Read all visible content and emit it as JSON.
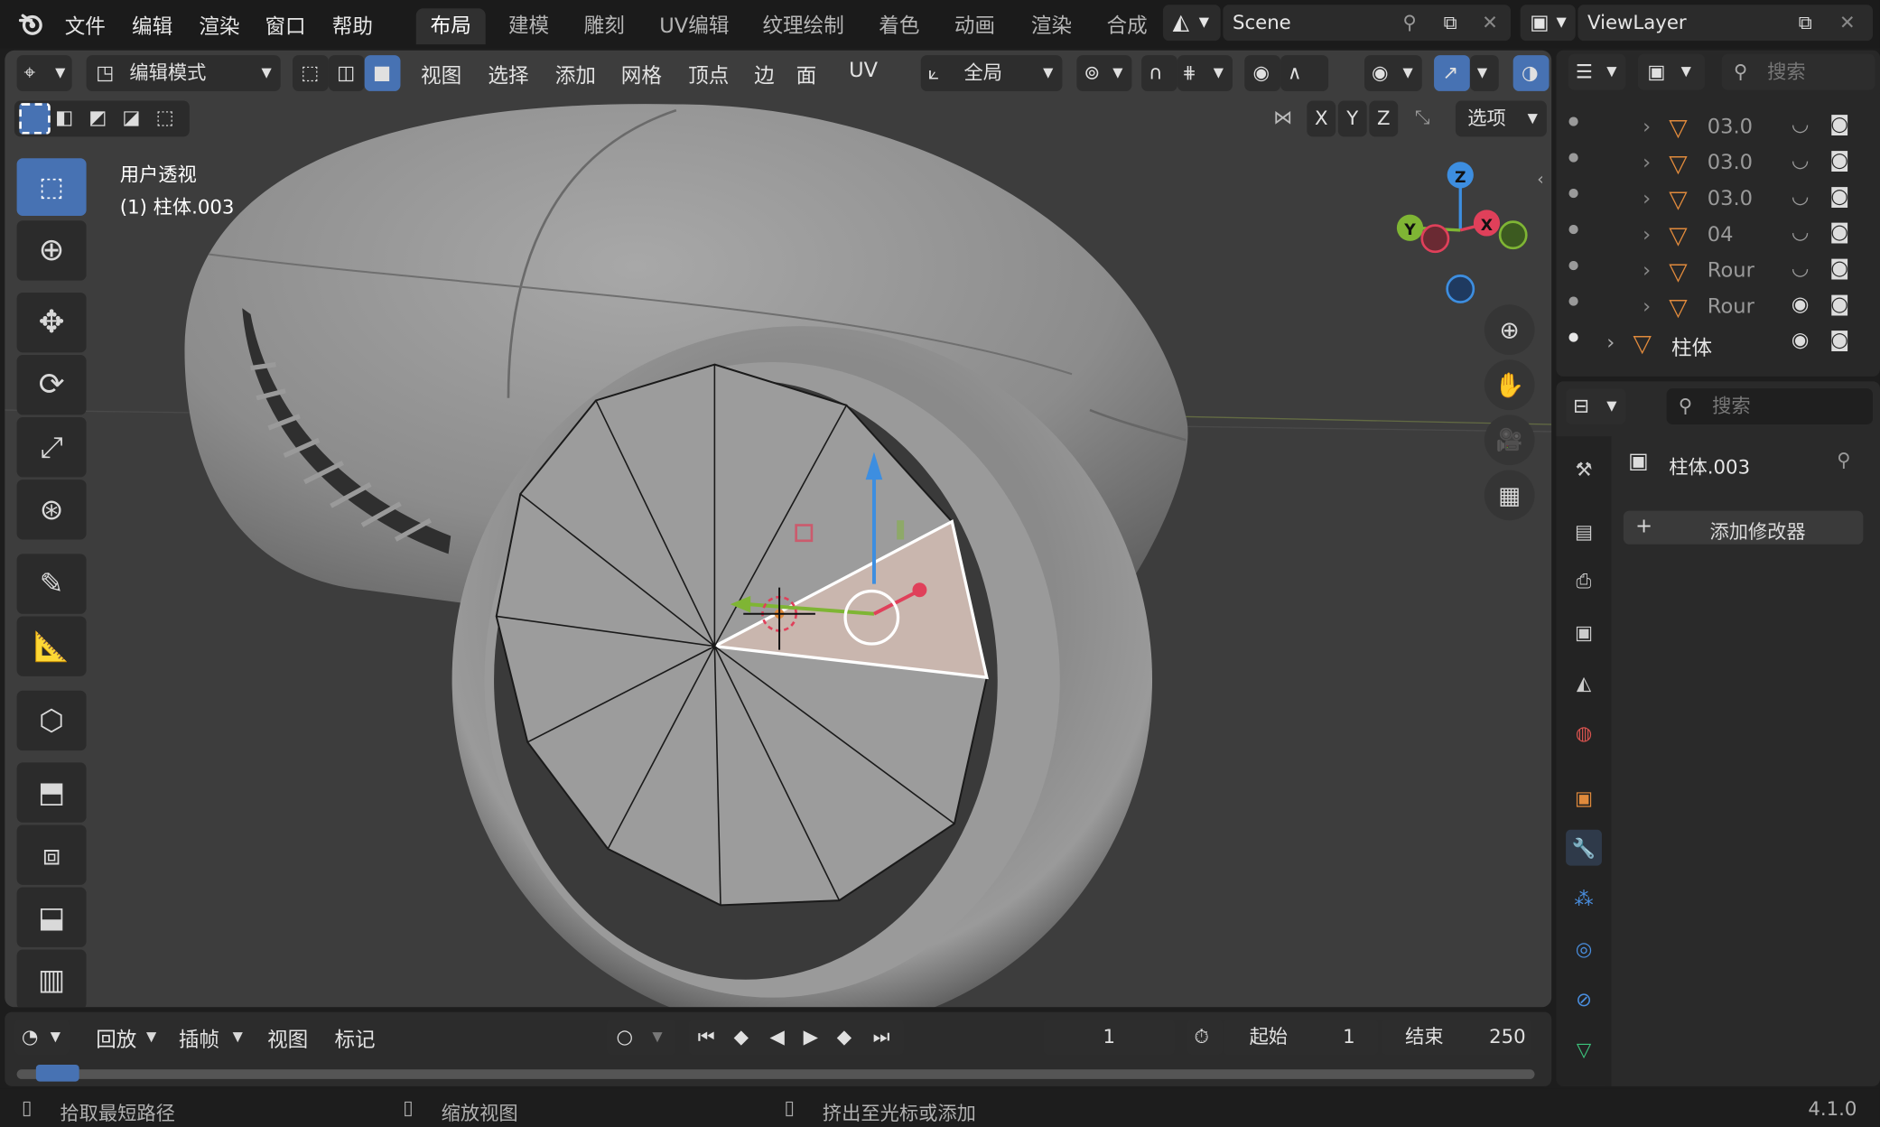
{
  "menubar": {
    "menus": [
      "文件",
      "编辑",
      "渲染",
      "窗口",
      "帮助"
    ],
    "workspaces": [
      "布局",
      "建模",
      "雕刻",
      "UV编辑",
      "纹理绘制",
      "着色",
      "动画",
      "渲染",
      "合成"
    ],
    "active_workspace": "布局",
    "scene": "Scene",
    "view_layer": "ViewLayer"
  },
  "viewport_header": {
    "mode": "编辑模式",
    "menus": [
      "视图",
      "选择",
      "添加",
      "网格",
      "顶点",
      "边",
      "面",
      "UV"
    ],
    "orientation": "全局",
    "axes": [
      "X",
      "Y",
      "Z"
    ],
    "options": "选项"
  },
  "viewport": {
    "view_name": "用户透视",
    "object_name": "(1) 柱体.003",
    "gizmo_axes": [
      "Z",
      "Y",
      "X"
    ]
  },
  "outliner": {
    "search_placeholder": "搜索",
    "rows": [
      {
        "name": "03.0"
      },
      {
        "name": "03.0"
      },
      {
        "name": "03.0"
      },
      {
        "name": "04"
      },
      {
        "name": "Rour"
      },
      {
        "name": "Rour"
      },
      {
        "name": "柱体"
      }
    ]
  },
  "properties": {
    "search_placeholder": "搜索",
    "object_name": "柱体.003",
    "add_modifier": "添加修改器"
  },
  "timeline": {
    "menus": [
      "回放",
      "插帧",
      "视图",
      "标记"
    ],
    "current_frame": "1",
    "start_label": "起始",
    "start_value": "1",
    "end_label": "结束",
    "end_value": "250"
  },
  "statusbar": {
    "items": [
      "拾取最短路径",
      "缩放视图",
      "挤出至光标或添加"
    ],
    "version": "4.1.0"
  },
  "colors": {
    "accent": "#4772b3",
    "x_axis": "#e0405a",
    "y_axis": "#7fb534",
    "z_axis": "#3d8ee0",
    "object_icon": "#e08a3c"
  }
}
